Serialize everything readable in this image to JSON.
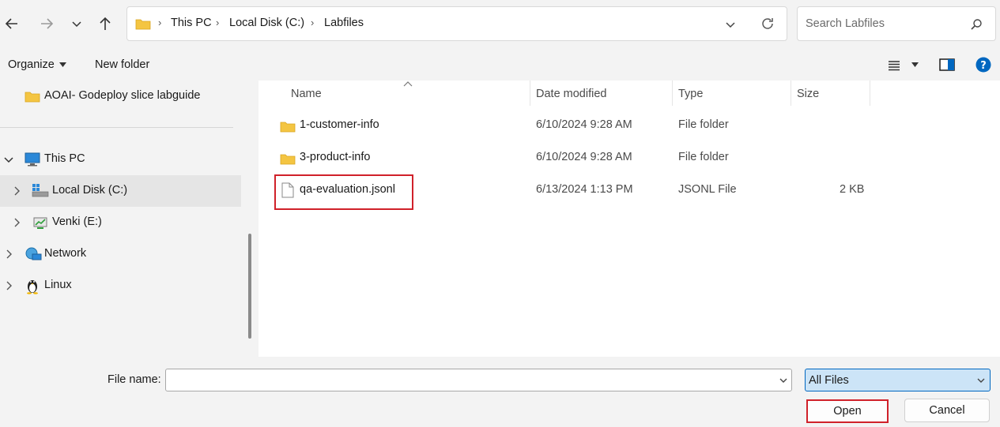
{
  "breadcrumb": [
    "This PC",
    "Local Disk (C:)",
    "Labfiles"
  ],
  "search": {
    "placeholder": "Search Labfiles"
  },
  "toolbar": {
    "organize_label": "Organize",
    "new_folder_label": "New folder"
  },
  "nav": {
    "items": [
      {
        "label": "AOAI- Godeploy slice labguide",
        "icon": "folder-icon"
      },
      {
        "label": "This PC",
        "icon": "computer-icon"
      },
      {
        "label": "Local Disk (C:)",
        "icon": "drive-icon"
      },
      {
        "label": "Venki (E:)",
        "icon": "network-drive-icon"
      },
      {
        "label": "Network",
        "icon": "network-icon"
      },
      {
        "label": "Linux",
        "icon": "linux-icon"
      }
    ]
  },
  "columns": {
    "name": "Name",
    "date": "Date modified",
    "type": "Type",
    "size": "Size"
  },
  "files": [
    {
      "name": "1-customer-info",
      "date": "6/10/2024 9:28 AM",
      "type": "File folder",
      "size": "",
      "icon": "folder-icon"
    },
    {
      "name": "3-product-info",
      "date": "6/10/2024 9:28 AM",
      "type": "File folder",
      "size": "",
      "icon": "folder-icon"
    },
    {
      "name": "qa-evaluation.jsonl",
      "date": "6/13/2024 1:13 PM",
      "type": "JSONL File",
      "size": "2 KB",
      "icon": "file-icon"
    }
  ],
  "bottom": {
    "file_name_label": "File name:",
    "file_name_value": "",
    "file_type_value": "All Files",
    "open_label": "Open",
    "cancel_label": "Cancel"
  },
  "colors": {
    "accent": "#0067c0",
    "highlight": "#d0212a",
    "selected_nav": "#e5e5e5",
    "folder": "#f4c542"
  }
}
